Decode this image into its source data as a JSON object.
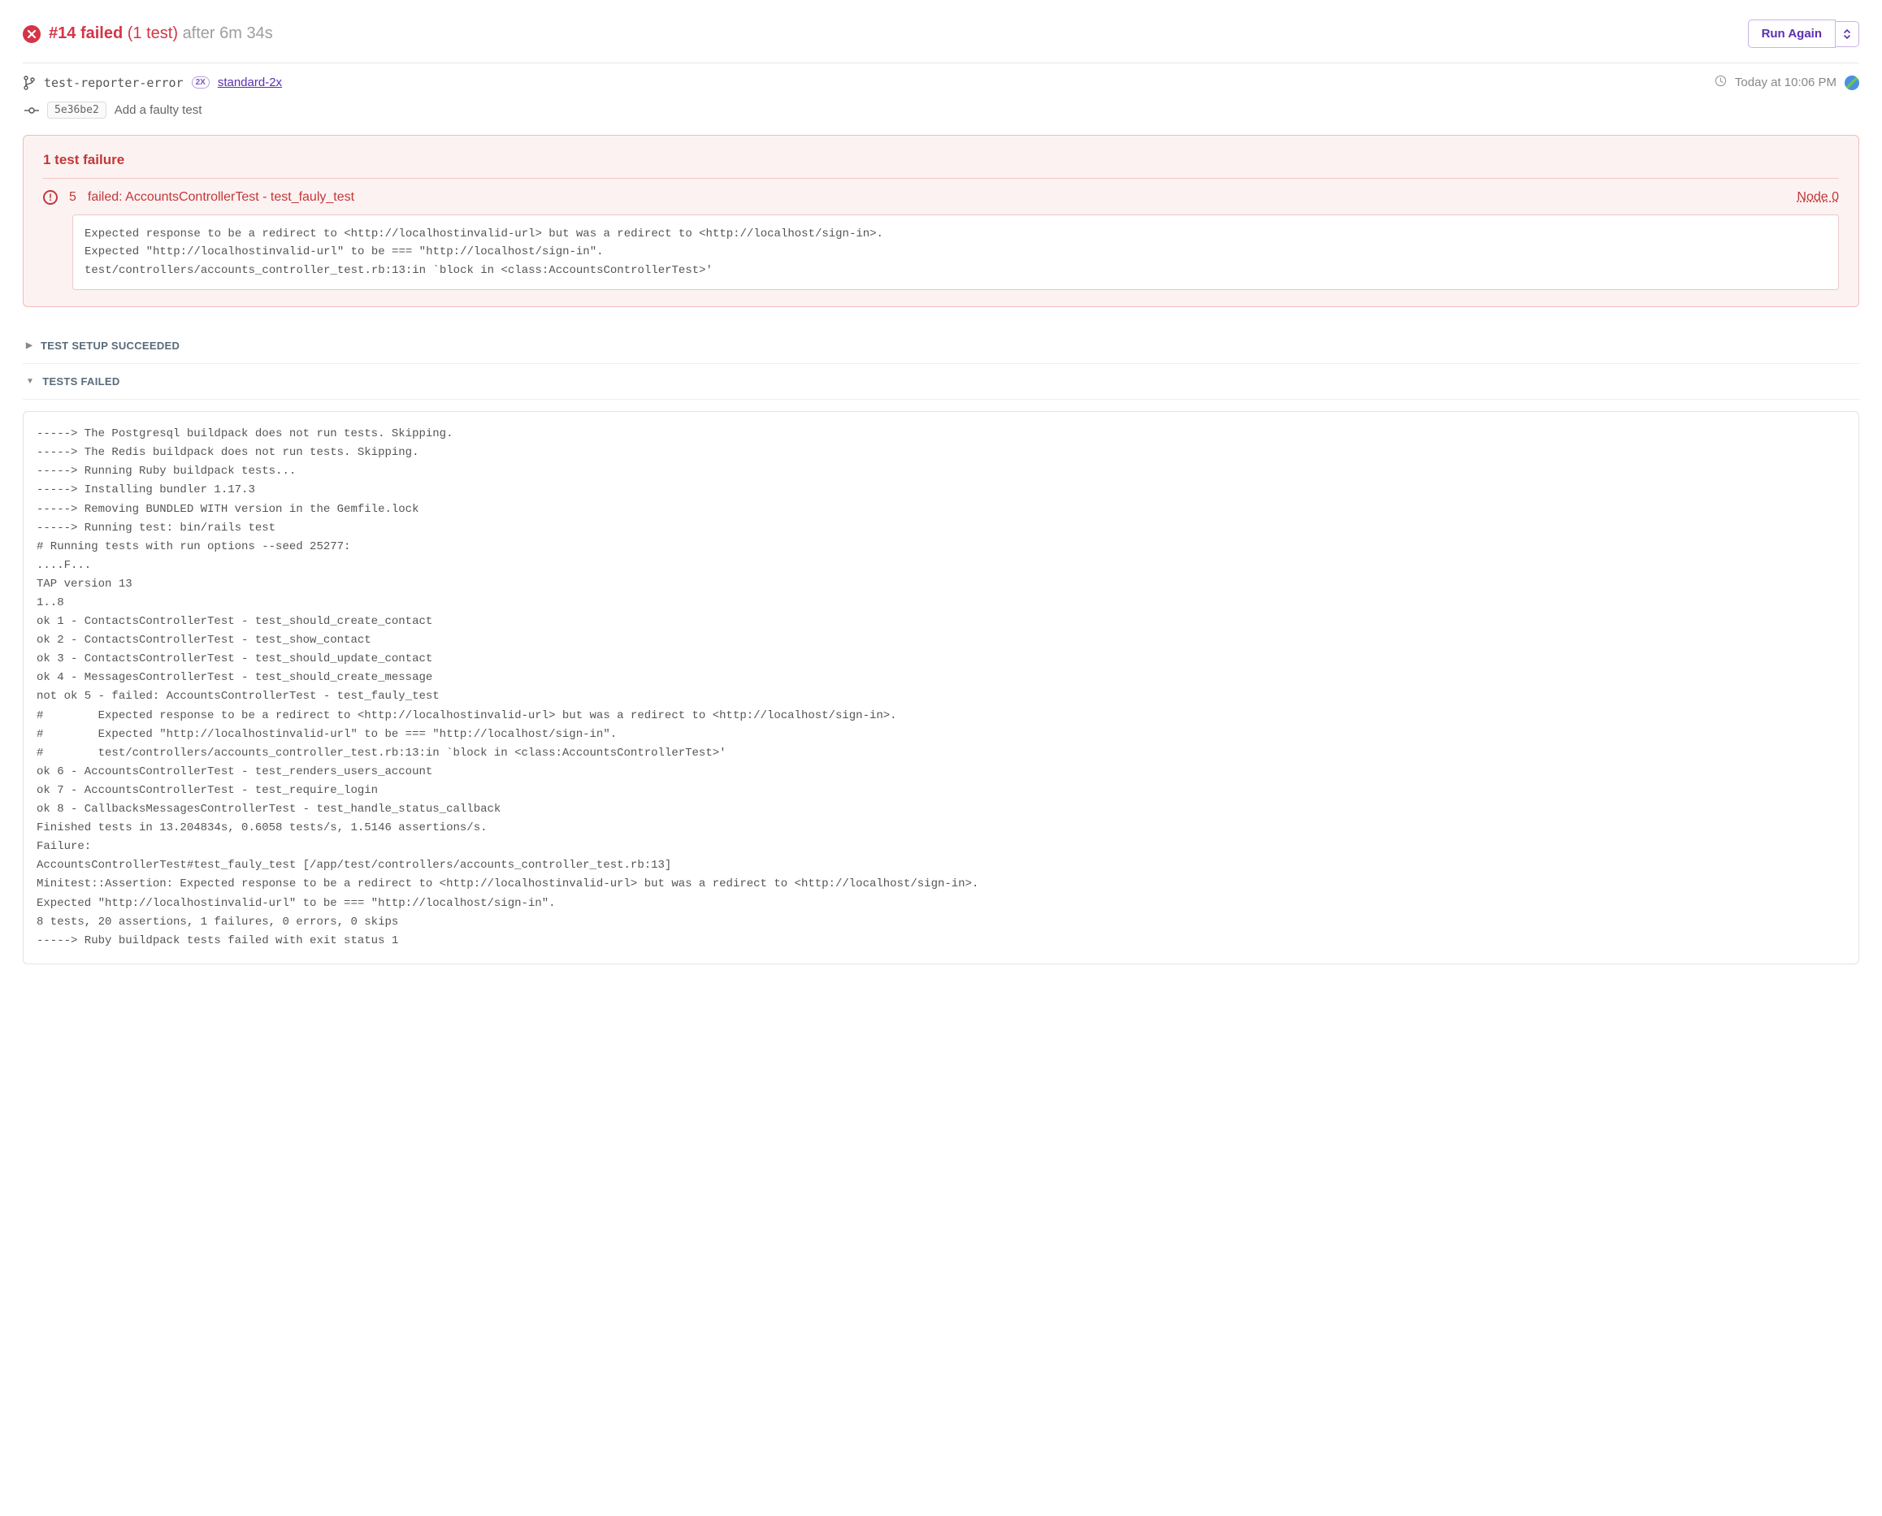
{
  "header": {
    "build_number": "#14",
    "status": "failed",
    "status_detail": "(1 test)",
    "duration": "after 6m 34s",
    "run_again_label": "Run Again"
  },
  "meta": {
    "branch_name": "test-reporter-error",
    "dyno_badge": "2X",
    "dyno_link": "standard-2x",
    "time_text": "Today at 10:06 PM"
  },
  "commit": {
    "sha": "5e36be2",
    "message": "Add a faulty test"
  },
  "failure": {
    "title": "1 test failure",
    "count": "5",
    "name": "failed: AccountsControllerTest - test_fauly_test",
    "node_label": "Node 0",
    "details": "Expected response to be a redirect to <http://localhostinvalid-url> but was a redirect to <http://localhost/sign-in>.\nExpected \"http://localhostinvalid-url\" to be === \"http://localhost/sign-in\".\ntest/controllers/accounts_controller_test.rb:13:in `block in <class:AccountsControllerTest>'"
  },
  "sections": {
    "setup_label": "TEST SETUP SUCCEEDED",
    "tests_failed_label": "TESTS FAILED"
  },
  "log": "-----> The Postgresql buildpack does not run tests. Skipping.\n-----> The Redis buildpack does not run tests. Skipping.\n-----> Running Ruby buildpack tests...\n-----> Installing bundler 1.17.3\n-----> Removing BUNDLED WITH version in the Gemfile.lock\n-----> Running test: bin/rails test\n# Running tests with run options --seed 25277:\n....F...\nTAP version 13\n1..8\nok 1 - ContactsControllerTest - test_should_create_contact\nok 2 - ContactsControllerTest - test_show_contact\nok 3 - ContactsControllerTest - test_should_update_contact\nok 4 - MessagesControllerTest - test_should_create_message\nnot ok 5 - failed: AccountsControllerTest - test_fauly_test\n#        Expected response to be a redirect to <http://localhostinvalid-url> but was a redirect to <http://localhost/sign-in>.\n#        Expected \"http://localhostinvalid-url\" to be === \"http://localhost/sign-in\".\n#        test/controllers/accounts_controller_test.rb:13:in `block in <class:AccountsControllerTest>'\nok 6 - AccountsControllerTest - test_renders_users_account\nok 7 - AccountsControllerTest - test_require_login\nok 8 - CallbacksMessagesControllerTest - test_handle_status_callback\nFinished tests in 13.204834s, 0.6058 tests/s, 1.5146 assertions/s.\nFailure:\nAccountsControllerTest#test_fauly_test [/app/test/controllers/accounts_controller_test.rb:13]\nMinitest::Assertion: Expected response to be a redirect to <http://localhostinvalid-url> but was a redirect to <http://localhost/sign-in>.\nExpected \"http://localhostinvalid-url\" to be === \"http://localhost/sign-in\".\n8 tests, 20 assertions, 1 failures, 0 errors, 0 skips\n-----> Ruby buildpack tests failed with exit status 1"
}
